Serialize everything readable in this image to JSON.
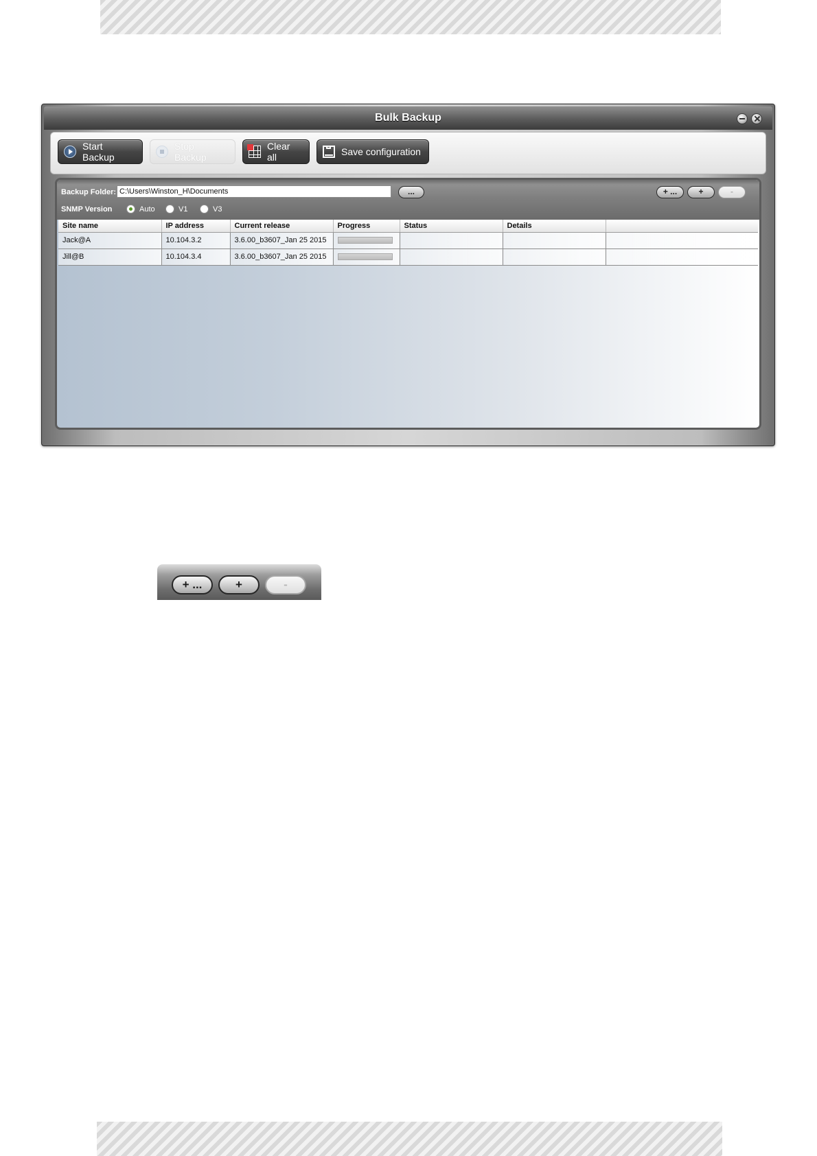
{
  "window": {
    "title": "Bulk Backup"
  },
  "toolbar": {
    "start_label": "Start Backup",
    "stop_label": "Stop Backup",
    "clear_label": "Clear all",
    "save_label": "Save configuration"
  },
  "folder": {
    "label": "Backup Folder:",
    "value": "C:\\Users\\Winston_H\\Documents",
    "browse_label": "..."
  },
  "snmp": {
    "label": "SNMP Version",
    "options": [
      "Auto",
      "V1",
      "V3"
    ],
    "selected": "Auto"
  },
  "actions": {
    "add_many_label": "+ ...",
    "add_label": "+",
    "remove_label": "-"
  },
  "table": {
    "columns": [
      "Site name",
      "IP address",
      "Current release",
      "Progress",
      "Status",
      "Details"
    ],
    "rows": [
      {
        "site": "Jack@A",
        "ip": "10.104.3.2",
        "release": "3.6.00_b3607_Jan 25 2015",
        "status": "",
        "details": ""
      },
      {
        "site": "Jill@B",
        "ip": "10.104.3.4",
        "release": "3.6.00_b3607_Jan 25 2015",
        "status": "",
        "details": ""
      }
    ]
  },
  "zoom": {
    "add_many_label": "+ ...",
    "add_label": "+",
    "remove_label": "-"
  }
}
